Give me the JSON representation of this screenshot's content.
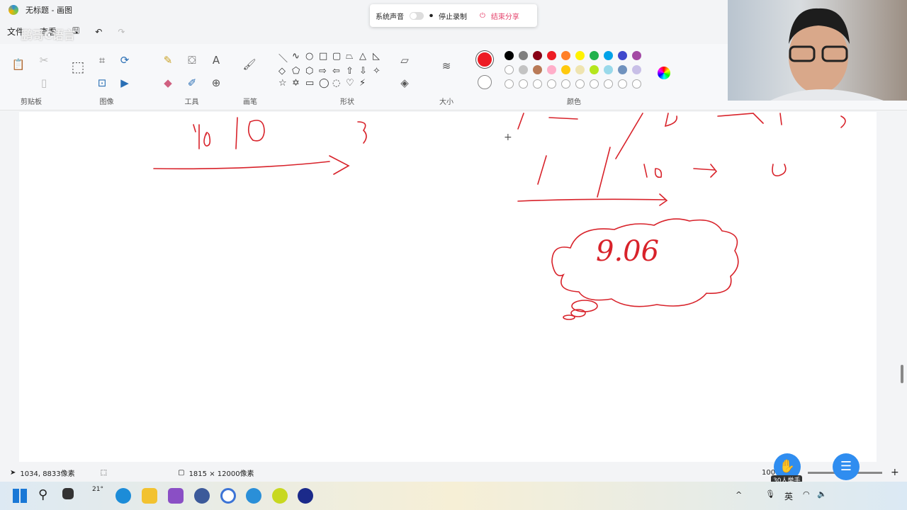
{
  "window": {
    "title": "无标题 - 画图"
  },
  "menu": {
    "file": "文件",
    "view": "查看",
    "watermark": "鹏哥C语言"
  },
  "ribbon": {
    "groups": {
      "clipboard": "剪贴板",
      "image": "图像",
      "tools": "工具",
      "brushes": "画笔",
      "shapes": "形状",
      "size": "大小",
      "colors": "颜色"
    },
    "shapes": [
      "＼",
      "∿",
      "○",
      "□",
      "▢",
      "⏢",
      "△",
      "◺",
      "◇",
      "⬠",
      "⬡",
      "⇨",
      "⇦",
      "⇧",
      "⇩",
      "✧",
      "☆",
      "✡",
      "▭",
      "◯",
      "◌",
      "♡",
      "⚡"
    ],
    "palette": [
      "#000000",
      "#7f7f7f",
      "#880015",
      "#ed1c24",
      "#ff7f27",
      "#fff200",
      "#22b14c",
      "#00a2e8",
      "#3f48cc",
      "#a349a4",
      "#ffffff",
      "#c3c3c3",
      "#b97a57",
      "#ffaec9",
      "#ffc90e",
      "#efe4b0",
      "#b5e61d",
      "#99d9ea",
      "#7092be",
      "#c8bfe7",
      "",
      "",
      "",
      "",
      "",
      "",
      "",
      "",
      "",
      ""
    ],
    "color1": "#ed1c24",
    "color2": "#ffffff"
  },
  "share_bar": {
    "system_sound": "系统声音",
    "stop_recording": "停止录制",
    "end_share": "结束分享"
  },
  "canvas": {
    "bubble_text": "9.06"
  },
  "status": {
    "cursor": "1034, 8833像素",
    "size": "1815 × 12000像素",
    "zoom": "100%",
    "raise_hand": "30人举手"
  },
  "taskbar": {
    "weather": "21°",
    "ime": "英"
  },
  "accent": "#e51c23"
}
